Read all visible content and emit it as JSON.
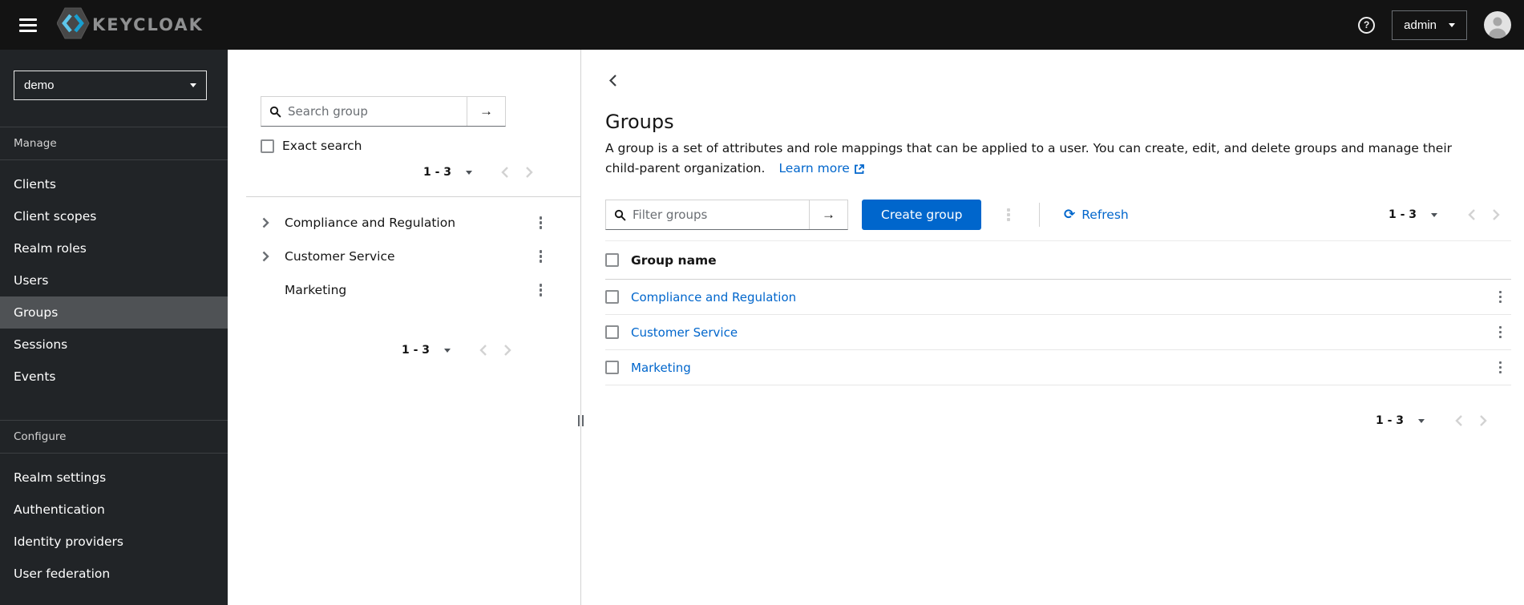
{
  "topbar": {
    "brand": "KEYCLOAK",
    "user_menu": {
      "label": "admin"
    }
  },
  "sidebar": {
    "realm_selector": {
      "value": "demo"
    },
    "sections": [
      {
        "title": "Manage",
        "items": [
          {
            "label": "Clients",
            "active": false
          },
          {
            "label": "Client scopes",
            "active": false
          },
          {
            "label": "Realm roles",
            "active": false
          },
          {
            "label": "Users",
            "active": false
          },
          {
            "label": "Groups",
            "active": true
          },
          {
            "label": "Sessions",
            "active": false
          },
          {
            "label": "Events",
            "active": false
          }
        ]
      },
      {
        "title": "Configure",
        "items": [
          {
            "label": "Realm settings",
            "active": false
          },
          {
            "label": "Authentication",
            "active": false
          },
          {
            "label": "Identity providers",
            "active": false
          },
          {
            "label": "User federation",
            "active": false
          }
        ]
      }
    ]
  },
  "tree_panel": {
    "search": {
      "placeholder": "Search group"
    },
    "exact_search_label": "Exact search",
    "pagination_top": {
      "range": "1 - 3"
    },
    "groups": [
      {
        "name": "Compliance and Regulation",
        "expandable": true
      },
      {
        "name": "Customer Service",
        "expandable": true
      },
      {
        "name": "Marketing",
        "expandable": false
      }
    ],
    "pagination_bottom": {
      "range": "1 - 3"
    }
  },
  "main": {
    "title": "Groups",
    "description": {
      "line1": "A group is a set of attributes and role mappings that can be applied to a user. You can create, edit, and delete groups and manage their",
      "line2": "child-parent organization.",
      "learn_more_label": "Learn more"
    },
    "toolbar": {
      "filter_placeholder": "Filter groups",
      "create_label": "Create group",
      "refresh_label": "Refresh",
      "pagination": {
        "range": "1 - 3"
      }
    },
    "table": {
      "columns": [
        "Group name"
      ],
      "rows": [
        {
          "name": "Compliance and Regulation"
        },
        {
          "name": "Customer Service"
        },
        {
          "name": "Marketing"
        }
      ]
    },
    "pagination_bottom": {
      "range": "1 - 3"
    }
  },
  "icons": {
    "arrow_right": "→",
    "refresh_glyph": "⟳",
    "kebab": "vertical-ellipsis",
    "search": "magnifier",
    "caret_down": "triangle-down"
  },
  "colors": {
    "primary": "#0066cc",
    "link": "#0066cc",
    "topbar_bg": "#131313",
    "sidebar_bg": "#212427",
    "active_item_bg": "#4f5255"
  }
}
